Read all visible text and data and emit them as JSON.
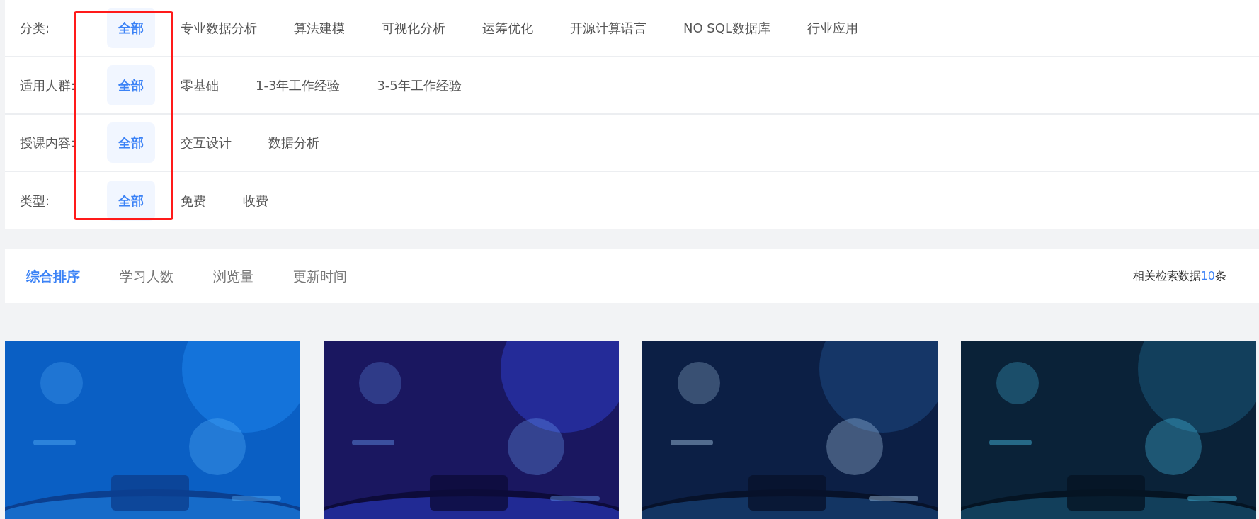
{
  "filters": [
    {
      "label": "分类:",
      "options": [
        {
          "text": "全部",
          "selected": true
        },
        {
          "text": "专业数据分析",
          "selected": false
        },
        {
          "text": "算法建模",
          "selected": false
        },
        {
          "text": "可视化分析",
          "selected": false
        },
        {
          "text": "运筹优化",
          "selected": false
        },
        {
          "text": "开源计算语言",
          "selected": false
        },
        {
          "text": "NO SQL数据库",
          "selected": false
        },
        {
          "text": "行业应用",
          "selected": false
        }
      ]
    },
    {
      "label": "适用人群:",
      "options": [
        {
          "text": "全部",
          "selected": true
        },
        {
          "text": "零基础",
          "selected": false
        },
        {
          "text": "1-3年工作经验",
          "selected": false
        },
        {
          "text": "3-5年工作经验",
          "selected": false
        }
      ]
    },
    {
      "label": "授课内容:",
      "options": [
        {
          "text": "全部",
          "selected": true
        },
        {
          "text": "交互设计",
          "selected": false
        },
        {
          "text": "数据分析",
          "selected": false
        }
      ]
    },
    {
      "label": "类型:",
      "options": [
        {
          "text": "全部",
          "selected": true
        },
        {
          "text": "免费",
          "selected": false
        },
        {
          "text": "收费",
          "selected": false
        }
      ]
    }
  ],
  "sort_tabs": [
    {
      "text": "综合排序",
      "selected": true
    },
    {
      "text": "学习人数",
      "selected": false
    },
    {
      "text": "浏览量",
      "selected": false
    },
    {
      "text": "更新时间",
      "selected": false
    }
  ],
  "result_count": {
    "prefix": "相关检索数据",
    "count": "10",
    "suffix": "条"
  }
}
